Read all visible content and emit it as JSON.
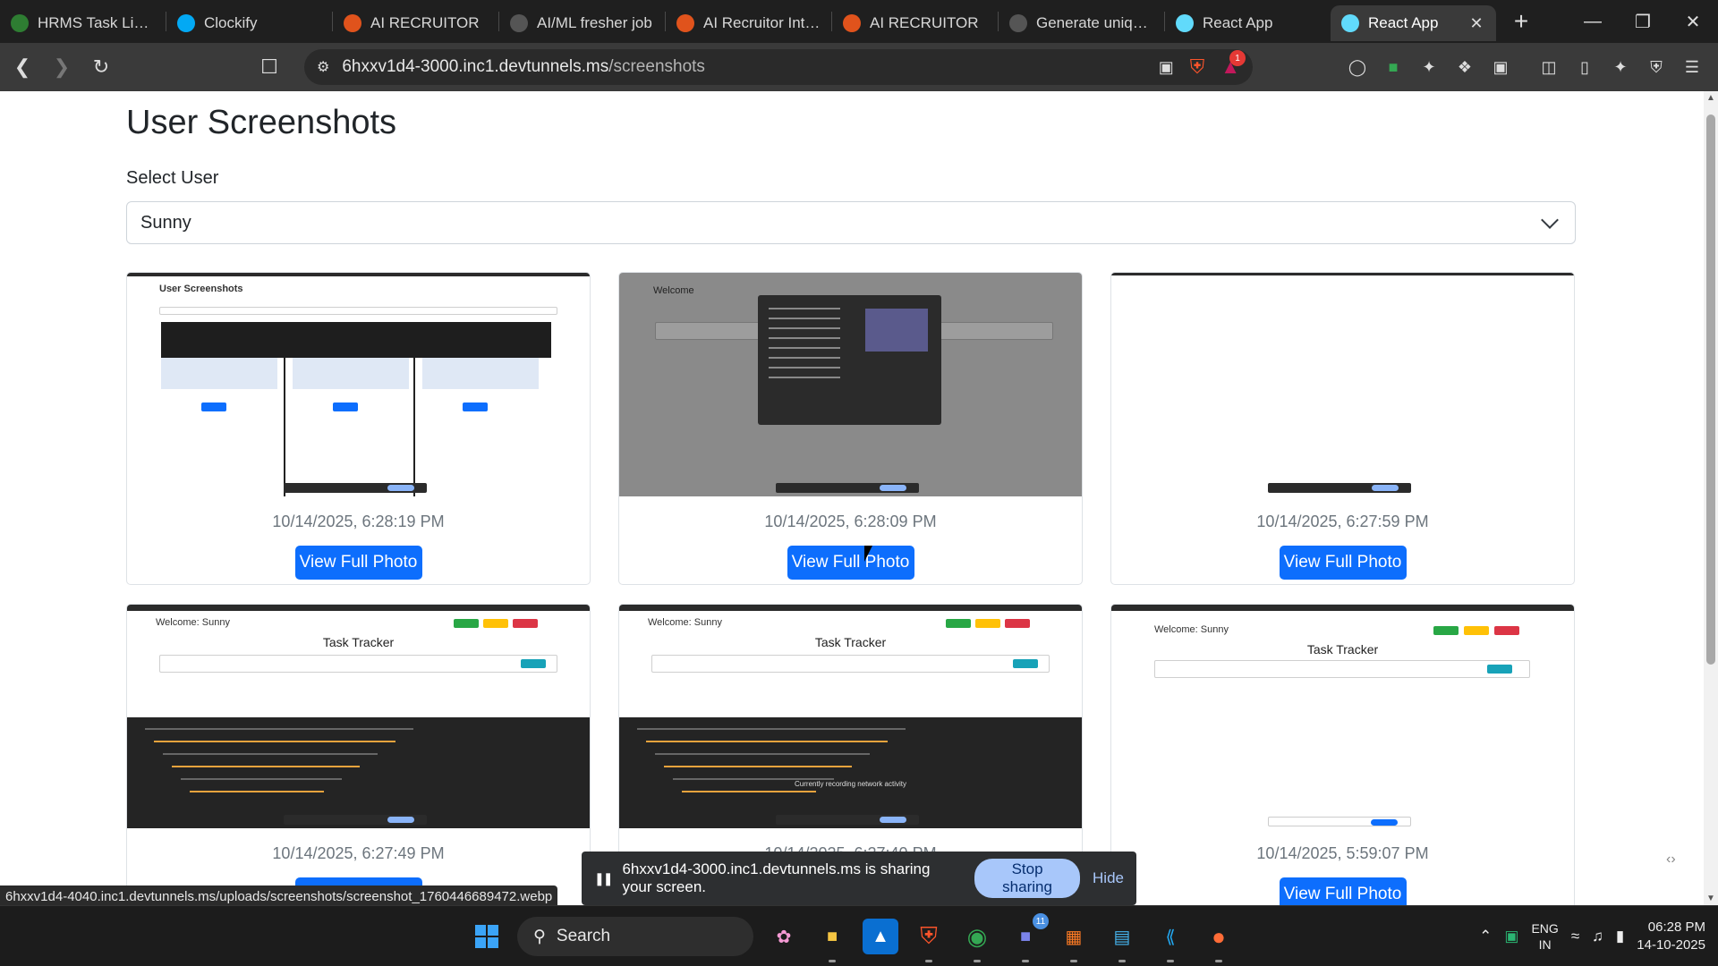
{
  "browser": {
    "tabs": [
      {
        "label": "HRMS Task List - C",
        "icon": "hrms-icon",
        "color": "#2e7d32"
      },
      {
        "label": "Clockify",
        "icon": "clockify-icon",
        "color": "#03a9f4"
      },
      {
        "label": "AI RECRUITOR",
        "icon": "brave-icon",
        "color": "#e0531c"
      },
      {
        "label": "AI/ML fresher job",
        "icon": "chatgpt-icon",
        "color": "#555555"
      },
      {
        "label": "AI Recruitor Interv",
        "icon": "brave-icon",
        "color": "#e0531c"
      },
      {
        "label": "AI RECRUITOR",
        "icon": "brave-icon",
        "color": "#e0531c"
      },
      {
        "label": "Generate unique ir",
        "icon": "chatgpt-icon",
        "color": "#555555"
      },
      {
        "label": "React App",
        "icon": "react-icon",
        "color": "#61dafb"
      },
      {
        "label": "React App",
        "icon": "react-icon",
        "color": "#61dafb",
        "active": true
      }
    ],
    "address": {
      "host": "6hxxv1d4-3000.inc1.devtunnels.ms",
      "path": "/screenshots"
    },
    "notification_count": "1"
  },
  "page": {
    "title": "User Screenshots",
    "select_label": "Select User",
    "selected_user": "Sunny",
    "view_button_label": "View Full Photo",
    "cards": [
      {
        "timestamp": "10/14/2025, 6:28:19 PM",
        "thumb": "gallery"
      },
      {
        "timestamp": "10/14/2025, 6:28:09 PM",
        "thumb": "picker"
      },
      {
        "timestamp": "10/14/2025, 6:27:59 PM",
        "thumb": "blank"
      },
      {
        "timestamp": "10/14/2025, 6:27:49 PM",
        "thumb": "tracker-devtools"
      },
      {
        "timestamp": "10/14/2025, 6:27:40 PM",
        "thumb": "tracker-network"
      },
      {
        "timestamp": "10/14/2025, 5:59:07 PM",
        "thumb": "tracker-plain"
      }
    ],
    "thumb_texts": {
      "welcome": "Welcome: Sunny",
      "tracker": "Task Tracker",
      "gallery_title": "User Screenshots",
      "picker_welcome": "Welcome",
      "network_msg": "Currently recording network activity"
    }
  },
  "status_url": "6hxxv1d4-4040.inc1.devtunnels.ms/uploads/screenshots/screenshot_1760446689472.webp",
  "share_bar": {
    "message": "6hxxv1d4-3000.inc1.devtunnels.ms is sharing your screen.",
    "stop_label": "Stop sharing",
    "hide_label": "Hide"
  },
  "taskbar": {
    "search_label": "Search",
    "teams_badge": "11",
    "lang_line1": "ENG",
    "lang_line2": "IN",
    "time": "06:28 PM",
    "date": "14-10-2025"
  }
}
